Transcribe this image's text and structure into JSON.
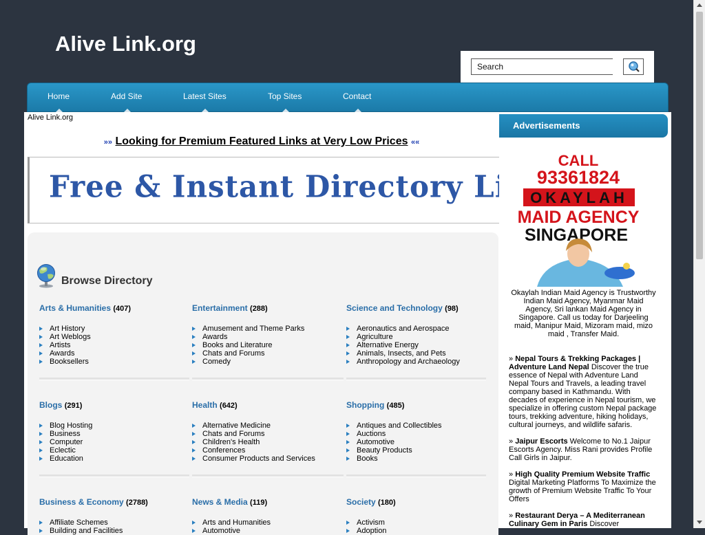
{
  "site": {
    "title": "Alive Link.org"
  },
  "search": {
    "value": "Search"
  },
  "nav": {
    "items": [
      "Home",
      "Add Site",
      "Latest Sites",
      "Top Sites",
      "Contact"
    ]
  },
  "breadcrumb": "Alive Link.org",
  "promo": {
    "left_arrows": "»»",
    "text": "Looking for Premium Featured Links at Very Low Prices",
    "right_arrows": "««"
  },
  "banner": {
    "text": "Free & Instant Directory List"
  },
  "directory": {
    "title": "Browse Directory",
    "categories": [
      {
        "name": "Arts & Humanities",
        "count": "(407)",
        "items": [
          "Art History",
          "Art Weblogs",
          "Artists",
          "Awards",
          "Booksellers"
        ]
      },
      {
        "name": "Entertainment",
        "count": "(288)",
        "items": [
          "Amusement and Theme Parks",
          "Awards",
          "Books and Literature",
          "Chats and Forums",
          "Comedy"
        ]
      },
      {
        "name": "Science and Technology",
        "count": "(98)",
        "items": [
          "Aeronautics and Aerospace",
          "Agriculture",
          "Alternative Energy",
          "Animals, Insects, and Pets",
          "Anthropology and Archaeology"
        ]
      },
      {
        "name": "Blogs",
        "count": "(291)",
        "items": [
          "Blog Hosting",
          "Business",
          "Computer",
          "Eclectic",
          "Education"
        ]
      },
      {
        "name": "Health",
        "count": "(642)",
        "items": [
          "Alternative Medicine",
          "Chats and Forums",
          "Children's Health",
          "Conferences",
          "Consumer Products and Services"
        ]
      },
      {
        "name": "Shopping",
        "count": "(485)",
        "items": [
          "Antiques and Collectibles",
          "Auctions",
          "Automotive",
          "Beauty Products",
          "Books"
        ]
      },
      {
        "name": "Business & Economy",
        "count": "(2788)",
        "items": [
          "Affiliate Schemes",
          "Building and Facilities"
        ]
      },
      {
        "name": "News & Media",
        "count": "(119)",
        "items": [
          "Arts and Humanities",
          "Automotive"
        ]
      },
      {
        "name": "Society",
        "count": "(180)",
        "items": [
          "Activism",
          "Adoption"
        ]
      }
    ]
  },
  "sidebar": {
    "heading": "Advertisements",
    "ad_image": {
      "line1": "CALL",
      "line2": "93361824",
      "line3": "OKAYLAH",
      "line4": "MAID AGENCY",
      "line5": "SINGAPORE"
    },
    "ad_caption": "Okaylah Indian Maid Agency is Trustworthy Indian Maid Agency, Myanmar Maid Agency, Sri lankan Maid Agency in Singapore. Call us today for Darjeeling maid, Manipur Maid, Mizoram maid, mizo maid , Transfer Maid.",
    "links": [
      {
        "title": "Nepal Tours & Trekking Packages | Adventure Land Nepal",
        "desc": "Discover the true essence of Nepal with Adventure Land Nepal Tours and Travels, a leading travel company based in Kathmandu. With decades of experience in Nepal tourism, we specialize in offering custom Nepal package tours, trekking adventure, hiking holidays, cultural journeys, and wildlife safaris."
      },
      {
        "title": "Jaipur Escorts",
        "desc": "Welcome to No.1 Jaipur Escorts Agency. Miss Rani provides Profile Call Girls in Jaipur."
      },
      {
        "title": "High Quality Premium Website Traffic",
        "desc": "Digital Marketing Platforms To Maximize the growth of Premium Website Traffic To Your Offers"
      },
      {
        "title": "Restaurant Derya – A Mediterranean Culinary Gem in Paris",
        "desc": "Discover"
      }
    ]
  },
  "colors": {
    "background": "#2c3440",
    "nav": "#1f86b8",
    "category_link": "#2a6ea8",
    "banner_text": "#2d57a6"
  }
}
